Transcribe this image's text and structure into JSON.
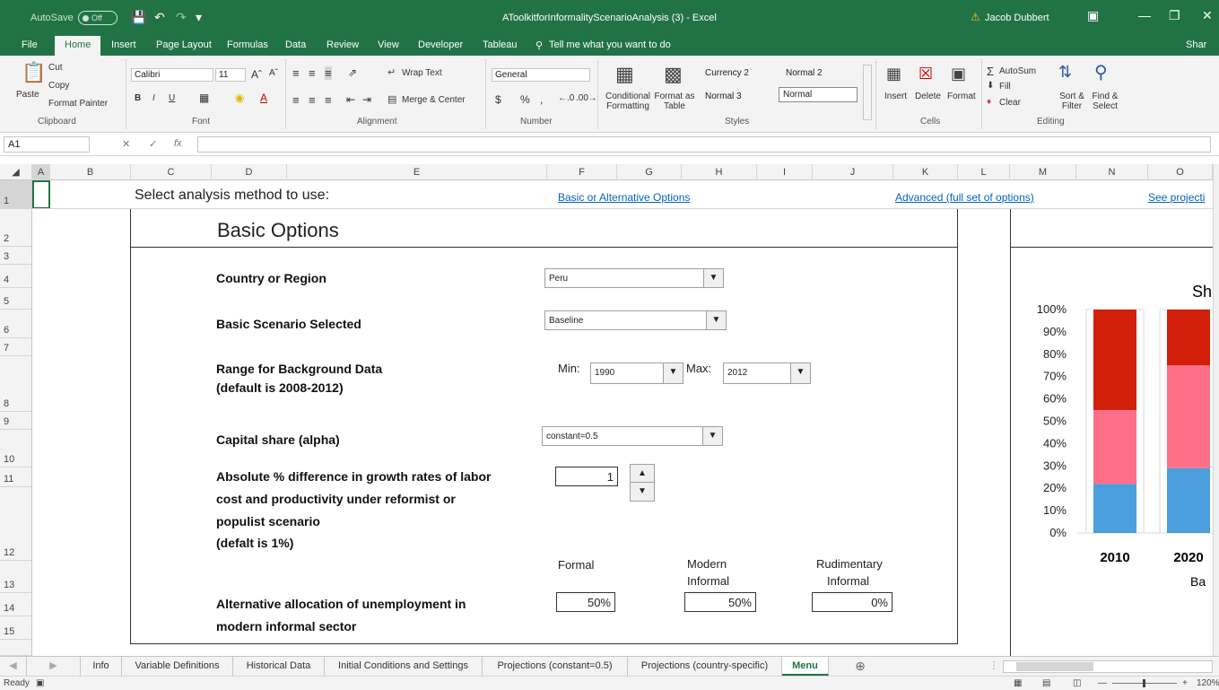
{
  "titlebar": {
    "autosave_label": "AutoSave",
    "autosave_state": "Off",
    "doc_title": "AToolkitforInformalityScenarioAnalysis (3)  -  Excel",
    "user_name": "Jacob Dubbert",
    "accent_color": "#217346"
  },
  "tabs": [
    "File",
    "Home",
    "Insert",
    "Page Layout",
    "Formulas",
    "Data",
    "Review",
    "View",
    "Developer",
    "Tableau"
  ],
  "tell_me": "Tell me what you want to do",
  "share": "Shar",
  "ribbon": {
    "clipboard": {
      "paste": "Paste",
      "cut": "Cut",
      "copy": "Copy",
      "format_painter": "Format Painter",
      "label": "Clipboard"
    },
    "font": {
      "name": "Calibri",
      "size": "11",
      "label": "Font"
    },
    "alignment": {
      "wrap": "Wrap Text",
      "merge": "Merge & Center",
      "label": "Alignment"
    },
    "number": {
      "format": "General",
      "label": "Number"
    },
    "styles": {
      "conditional": "Conditional Formatting",
      "format_table": "Format as Table",
      "cells": [
        "Currency 2",
        "Normal 2",
        "Normal 3",
        "Normal"
      ],
      "label": "Styles"
    },
    "cells": {
      "insert": "Insert",
      "delete": "Delete",
      "format": "Format",
      "label": "Cells"
    },
    "editing": {
      "autosum": "AutoSum",
      "fill": "Fill",
      "clear": "Clear",
      "sort": "Sort & Filter",
      "find": "Find & Select",
      "label": "Editing"
    }
  },
  "formula_bar": {
    "name_box": "A1",
    "fx": "fx",
    "value": ""
  },
  "columns": [
    "A",
    "B",
    "C",
    "D",
    "E",
    "F",
    "G",
    "H",
    "I",
    "J",
    "K",
    "L",
    "M",
    "N",
    "O"
  ],
  "rows": [
    "1",
    "2",
    "3",
    "4",
    "5",
    "6",
    "7",
    "8",
    "9",
    "10",
    "11",
    "12",
    "13",
    "14",
    "15"
  ],
  "sheet": {
    "select_method": "Select analysis method to use:",
    "link_basic": "Basic or Alternative Options",
    "link_advanced": "Advanced (full set of options)",
    "link_projections": "See projecti",
    "heading": "Basic Options",
    "country_label": "Country or Region",
    "country_value": "Peru",
    "scenario_label": "Basic Scenario Selected",
    "scenario_value": "Baseline",
    "range_label_1": "Range for Background Data",
    "range_label_2": "(default is 2008-2012)",
    "min_label": "Min:",
    "min_value": "1990",
    "max_label": "Max:",
    "max_value": "2012",
    "capital_label": "Capital share (alpha)",
    "capital_value": "constant=0.5",
    "abs_label_1": "Absolute % difference in growth rates of labor",
    "abs_label_2": "cost and productivity under reformist or",
    "abs_label_3": "populist scenario",
    "abs_label_4": "(defalt is 1%)",
    "abs_value": "1",
    "col_formal": "Formal",
    "col_modern_1": "Modern",
    "col_modern_2": "Informal",
    "col_rud_1": "Rudimentary",
    "col_rud_2": "Informal",
    "alloc_label_1": "Alternative allocation of unemployment in",
    "alloc_label_2": "modern informal sector",
    "alloc_formal": "50%",
    "alloc_modern": "50%",
    "alloc_rud": "0%"
  },
  "chart_data": {
    "type": "bar",
    "stacked": true,
    "title": "Sh",
    "xlabel_partial": "Ba",
    "categories": [
      "2010",
      "2020"
    ],
    "yticks": [
      "0%",
      "10%",
      "20%",
      "30%",
      "40%",
      "50%",
      "60%",
      "70%",
      "80%",
      "90%",
      "100%"
    ],
    "ylim": [
      0,
      100
    ],
    "series": [
      {
        "values": [
          22,
          29
        ],
        "color": "#4a9fdc"
      },
      {
        "values": [
          33,
          46
        ],
        "color": "#ff6f87"
      },
      {
        "values": [
          45,
          25
        ],
        "color": "#d21f0a"
      }
    ]
  },
  "sheet_tabs": [
    "Info",
    "Variable Definitions",
    "Historical Data",
    "Initial Conditions and Settings",
    "Projections (constant=0.5)",
    "Projections (country-specific)",
    "Menu"
  ],
  "status": {
    "ready": "Ready",
    "zoom": "120%"
  }
}
